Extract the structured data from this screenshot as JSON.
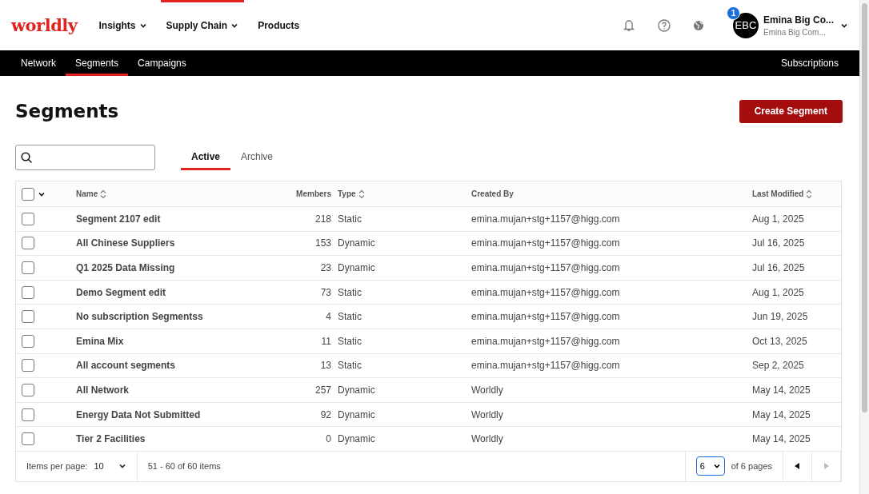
{
  "logo": "worldly",
  "top_nav": [
    {
      "label": "Insights",
      "dropdown": true,
      "selected": false
    },
    {
      "label": "Supply Chain",
      "dropdown": true,
      "selected": true
    },
    {
      "label": "Products",
      "dropdown": false,
      "selected": false
    }
  ],
  "user": {
    "initials": "EBC",
    "badge": "1",
    "name": "Emina Big Co...",
    "company": "Emina Big Com..."
  },
  "sub_nav": [
    {
      "label": "Network",
      "selected": false
    },
    {
      "label": "Segments",
      "selected": true
    },
    {
      "label": "Campaigns",
      "selected": false
    }
  ],
  "sub_nav_right": "Subscriptions",
  "page_title": "Segments",
  "create_button": "Create Segment",
  "tabs": [
    {
      "label": "Active",
      "selected": true
    },
    {
      "label": "Archive",
      "selected": false
    }
  ],
  "table": {
    "columns": [
      {
        "label": "Name",
        "sortable": true
      },
      {
        "label": "Members",
        "sortable": false
      },
      {
        "label": "Type",
        "sortable": true
      },
      {
        "label": "Created By",
        "sortable": false
      },
      {
        "label": "Last Modified",
        "sortable": true
      }
    ],
    "select_all_checked": false,
    "rows": [
      {
        "checked": false,
        "name": "Segment 2107 edit",
        "members": "218",
        "type": "Static",
        "created_by": "emina.mujan+stg+1157@higg.com",
        "modified": "Aug 1, 2025"
      },
      {
        "checked": false,
        "name": "All Chinese Suppliers",
        "members": "153",
        "type": "Dynamic",
        "created_by": "emina.mujan+stg+1157@higg.com",
        "modified": "Jul 16, 2025"
      },
      {
        "checked": false,
        "name": "Q1 2025 Data Missing",
        "members": "23",
        "type": "Dynamic",
        "created_by": "emina.mujan+stg+1157@higg.com",
        "modified": "Jul 16, 2025"
      },
      {
        "checked": false,
        "name": "Demo Segment edit",
        "members": "73",
        "type": "Static",
        "created_by": "emina.mujan+stg+1157@higg.com",
        "modified": "Aug 1, 2025"
      },
      {
        "checked": false,
        "name": "No subscription Segmentss",
        "members": "4",
        "type": "Static",
        "created_by": "emina.mujan+stg+1157@higg.com",
        "modified": "Jun 19, 2025"
      },
      {
        "checked": false,
        "name": "Emina Mix",
        "members": "11",
        "type": "Static",
        "created_by": "emina.mujan+stg+1157@higg.com",
        "modified": "Oct 13, 2025"
      },
      {
        "checked": false,
        "name": "All account segments",
        "members": "13",
        "type": "Static",
        "created_by": "emina.mujan+stg+1157@higg.com",
        "modified": "Sep 2, 2025"
      },
      {
        "checked": false,
        "name": "All Network",
        "members": "257",
        "type": "Dynamic",
        "created_by": "Worldly",
        "modified": "May 14, 2025"
      },
      {
        "checked": false,
        "name": "Energy Data Not Submitted",
        "members": "92",
        "type": "Dynamic",
        "created_by": "Worldly",
        "modified": "May 14, 2025"
      },
      {
        "checked": false,
        "name": "Tier 2 Facilities",
        "members": "0",
        "type": "Dynamic",
        "created_by": "Worldly",
        "modified": "May 14, 2025"
      }
    ]
  },
  "pagination": {
    "items_per_page_label": "Items per page:",
    "items_per_page": "10",
    "range": "51 - 60 of 60 items",
    "page": "6",
    "pages_label": "of 6 pages",
    "prev_disabled": false,
    "next_disabled": true
  }
}
